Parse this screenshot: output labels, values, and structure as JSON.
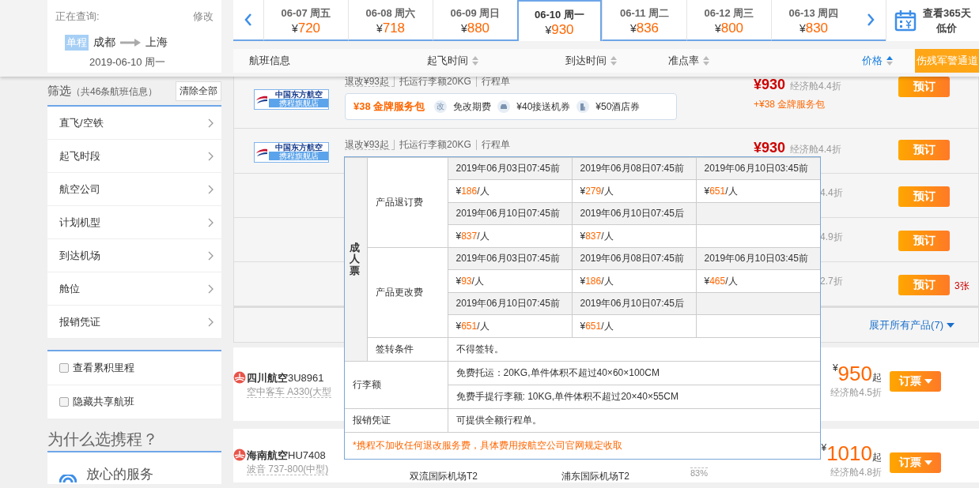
{
  "query": {
    "label": "正在查询:",
    "edit": "修改",
    "trip_type": "单程",
    "from": "成都",
    "to": "上海",
    "date": "2019-06-10 周一"
  },
  "dates": [
    {
      "date": "06-07 周五",
      "currency": "¥",
      "price": "720",
      "selected": false
    },
    {
      "date": "06-08 周六",
      "currency": "¥",
      "price": "718",
      "selected": false
    },
    {
      "date": "06-09 周日",
      "currency": "¥",
      "price": "880",
      "selected": false
    },
    {
      "date": "06-10 周一",
      "currency": "¥",
      "price": "930",
      "selected": true
    },
    {
      "date": "06-11 周二",
      "currency": "¥",
      "price": "836",
      "selected": false
    },
    {
      "date": "06-12 周三",
      "currency": "¥",
      "price": "800",
      "selected": false
    },
    {
      "date": "06-13 周四",
      "currency": "¥",
      "price": "830",
      "selected": false
    }
  ],
  "calendar": {
    "lines": [
      "查看365天",
      "低价"
    ]
  },
  "sort": [
    {
      "label": "航班信息",
      "kind": "plain",
      "selected": false
    },
    {
      "label": "起飞时间",
      "kind": "sortable",
      "selected": false
    },
    {
      "label": "到达时间",
      "kind": "sortable",
      "selected": false
    },
    {
      "label": "准点率",
      "kind": "sortable",
      "selected": false
    },
    {
      "label": "价格",
      "kind": "sortable",
      "selected": true
    }
  ],
  "special_button": "伤残军警通道",
  "filter": {
    "title": "筛选",
    "count": "（共46条航班信息）",
    "clear": "清除全部",
    "items": [
      "直飞/空铁",
      "起飞时段",
      "航空公司",
      "计划机型",
      "到达机场",
      "舱位",
      "报销凭证"
    ],
    "options": [
      {
        "label": "查看累积里程",
        "checked": false
      },
      {
        "label": "隐藏共享航班",
        "checked": false
      }
    ]
  },
  "why": {
    "title": "为什么选携程？",
    "items": [
      "放心的服务"
    ]
  },
  "group": {
    "rows": [
      {
        "kind": "full",
        "logo": {
          "name": "中国东方航空",
          "tag": "携程旗舰店"
        },
        "policy": [
          "退改¥93起",
          "托运行李额20KG",
          "行程单"
        ],
        "package": {
          "title": "¥38 金牌服务包",
          "perks": [
            {
              "kind": "badge",
              "badge": "改",
              "label": "免改期费"
            },
            {
              "kind": "car",
              "label": "¥40接送机券"
            },
            {
              "kind": "hotel",
              "label": "¥50酒店券"
            }
          ]
        },
        "price": "¥930",
        "discount": "经济舱4.4折",
        "extra": "+¥38 金牌服务包",
        "book": "预订"
      },
      {
        "kind": "full",
        "logo": {
          "name": "中国东方航空",
          "tag": "携程旗舰店"
        },
        "policy": [
          "退改¥93起",
          "托运行李额20KG",
          "行程单"
        ],
        "price": "¥930",
        "discount": "经济舱4.4折",
        "book": "预订"
      },
      {
        "kind": "partial",
        "discount": "4.4折",
        "book": "预订"
      },
      {
        "kind": "partial",
        "discount": "4.9折",
        "book": "预订"
      },
      {
        "kind": "partial",
        "discount": "2.7折",
        "book": "预订",
        "stock": "3张"
      }
    ],
    "expand": "展开所有产品(7)"
  },
  "flights": [
    {
      "airline": "四川航空",
      "code": "3U8961",
      "aircraft": "空中客车 A330(大型",
      "currency": "¥",
      "price": "950",
      "suffix": "起",
      "discount": "经济舱4.5折",
      "book": "订票"
    },
    {
      "airline": "海南航空",
      "code": "HU7408",
      "aircraft": "波音 737-800(中型)",
      "depart_airport": "双流国际机场T2",
      "arrive_airport": "浦东国际机场T2",
      "on_time": "83%",
      "currency": "¥",
      "price": "1010",
      "suffix": "起",
      "discount": "经济舱4.8折",
      "book": "订票"
    }
  ],
  "popup": {
    "side": "成人票",
    "sections": [
      {
        "label": "产品退订费",
        "entries": [
          {
            "time": "2019年06月03日07:45前",
            "currency": "¥",
            "amount": "186",
            "unit": "/人"
          },
          {
            "time": "2019年06月08日07:45前",
            "currency": "¥",
            "amount": "279",
            "unit": "/人"
          },
          {
            "time": "2019年06月10日03:45前",
            "currency": "¥",
            "amount": "651",
            "unit": "/人"
          },
          {
            "time": "2019年06月10日07:45前",
            "currency": "¥",
            "amount": "837",
            "unit": "/人"
          },
          {
            "time": "2019年06月10日07:45后",
            "currency": "¥",
            "amount": "837",
            "unit": "/人"
          }
        ]
      },
      {
        "label": "产品更改费",
        "entries": [
          {
            "time": "2019年06月03日07:45前",
            "currency": "¥",
            "amount": "93",
            "unit": "/人"
          },
          {
            "time": "2019年06月08日07:45前",
            "currency": "¥",
            "amount": "186",
            "unit": "/人"
          },
          {
            "time": "2019年06月10日03:45前",
            "currency": "¥",
            "amount": "465",
            "unit": "/人"
          },
          {
            "time": "2019年06月10日07:45前",
            "currency": "¥",
            "amount": "651",
            "unit": "/人"
          },
          {
            "time": "2019年06月10日07:45后",
            "currency": "¥",
            "amount": "651",
            "unit": "/人"
          }
        ]
      }
    ],
    "transfer": {
      "label": "签转条件",
      "text": "不得签转。"
    },
    "baggage": {
      "label": "行李额",
      "lines": [
        "免费托运：20KG,单件体积不超过40×60×100CM",
        "免费手提行李额: 10KG,单件体积不超过20×40×55CM"
      ]
    },
    "receipt": {
      "label": "报销凭证",
      "text": "可提供全额行程单。"
    },
    "note": "*携程不加收任何退改服务费，具体费用按航空公司官网规定收取"
  }
}
